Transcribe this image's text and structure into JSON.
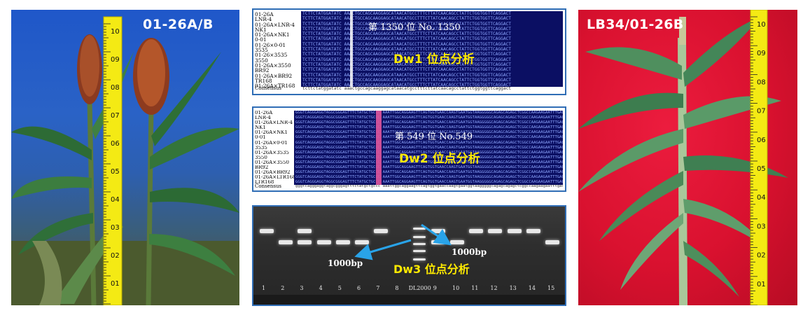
{
  "left_photo": {
    "label": "01-26A/B"
  },
  "right_photo": {
    "label": "LB34/01-26B"
  },
  "ruler_ticks": [
    "10",
    "09",
    "08",
    "07",
    "06",
    "05",
    "04",
    "03",
    "02",
    "01"
  ],
  "dw1": {
    "sample_names": [
      "01-26A",
      "LNR-4",
      "01-26A×LNR-4",
      "NK1",
      "01-26A×NK1",
      "0-01",
      "01-26×0-01",
      "3535",
      "01-26×3535",
      "3550",
      "01-26A×3550",
      "BR92",
      "01-26A×BR92",
      "TR168",
      "01-26A×TR168"
    ],
    "consensus_label": "Consensus",
    "sequence_row": "TCTTCTATGGATATC AAACTGCCAGCAAGGAGCATAACATGCCTTTCTTATCAACAGCCTATTCTGGTGGTTCAGGACT",
    "consensus_seq": "tcttctatggatatc aaactgccagcaaggagcataacatgcctttcttatcaacagcctattctggtggttcaggact",
    "position_text": "第 1350 位  No. 1350",
    "analysis_label": "Dw1 位点分析"
  },
  "dw2": {
    "sample_names": [
      "01-26A",
      "LNR-4",
      "01-26A×LNR-4",
      "NK1",
      "01-26A×NK1",
      "0-01",
      "01-26A×0-01",
      "3535",
      "01-26A×3535",
      "3550",
      "01-26A×3550",
      "BR92",
      "01-26A×BR92",
      "01-26A×LTR168",
      "LTR168"
    ],
    "consensus_label": "Consensus",
    "sequence_row": "GGGTCAGGGAGGTAGGCGGGAGTTTCTATGCTGCCC AAATTGGCAGGAAGTTCAGTGGTGAACCAAGTGAATGGTAAGGGGGCAGAGCAGAGCTCGGCCAAGAAGAATTTGACAAATTGG",
    "consensus_seq": "gggtcagggaggtaggcgggagtttctatgctgccc aaattggcaggaagttcagtggtgaaccaagtgaatggtaagggggcagagcagagctcggccaagaagaatttgac",
    "position_text": "第 549 位  No.549",
    "analysis_label": "Dw2 位点分析"
  },
  "dw3": {
    "lanes": [
      "1",
      "2",
      "3",
      "4",
      "5",
      "6",
      "7",
      "8",
      "DL2000",
      "9",
      "10",
      "11",
      "12",
      "13",
      "14",
      "15"
    ],
    "bp_left": "1000bp",
    "bp_right": "1000bp",
    "analysis_label": "Dw3 位点分析"
  },
  "colors": {
    "panel_border": "#2f6db5",
    "alignment_bg": "#0b0f63",
    "highlight_column": "#e0559c",
    "analysis_text": "#ffea00",
    "arrow": "#29a3e8",
    "ruler": "#f4ea14",
    "backdrop_red": "#d9112f",
    "sky_blue": "#2a62c6"
  }
}
